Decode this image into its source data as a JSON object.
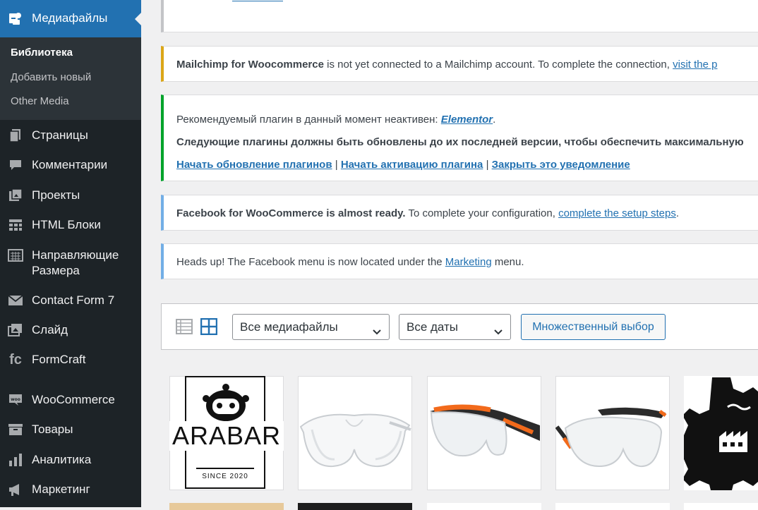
{
  "sidebar": {
    "active": {
      "label": "Медиафайлы",
      "icon": "media-icon"
    },
    "submenu": [
      {
        "label": "Библиотека",
        "current": true
      },
      {
        "label": "Добавить новый",
        "current": false
      },
      {
        "label": "Other Media",
        "current": false
      }
    ],
    "items": [
      {
        "label": "Страницы",
        "icon": "pages-icon"
      },
      {
        "label": "Комментарии",
        "icon": "comments-icon"
      },
      {
        "label": "Проекты",
        "icon": "portfolio-icon"
      },
      {
        "label": "HTML Блоки",
        "icon": "html-blocks-icon"
      },
      {
        "label": "Направляющие Размера",
        "line1": "Направляющие",
        "line2": "Размера",
        "icon": "size-guide-icon"
      },
      {
        "label": "Contact Form 7",
        "icon": "mail-icon"
      },
      {
        "label": "Слайд",
        "icon": "slides-icon"
      },
      {
        "label": "FormCraft",
        "icon": "formcraft-icon"
      },
      {
        "label": "WooCommerce",
        "icon": "woocommerce-icon"
      },
      {
        "label": "Товары",
        "icon": "products-icon"
      },
      {
        "label": "Аналитика",
        "icon": "analytics-icon"
      },
      {
        "label": "Маркетинг",
        "icon": "marketing-icon"
      }
    ]
  },
  "notices": {
    "mailchimp": {
      "bold": "Mailchimp for Woocommerce",
      "text": " is not yet connected to a Mailchimp account. To complete the connection, ",
      "link": "visit the p",
      "color": "#dba617"
    },
    "plugins": {
      "line1_text": "Рекомендуемый плагин в данный момент неактивен: ",
      "line1_link": "Elementor",
      "line1_end": ".",
      "line2_text": "Следующие плагины должны быть обновлены до их последней версии, чтобы обеспечить максимальную",
      "link_update": "Начать обновление плагинов",
      "sep": " | ",
      "link_activate": "Начать активацию плагина",
      "link_dismiss": "Закрыть это уведомление",
      "color": "#00a32a"
    },
    "facebook": {
      "bold": "Facebook for WooCommerce is almost ready.",
      "text": " To complete your configuration, ",
      "link": "complete the setup steps",
      "end": ".",
      "color": "#72aee6"
    },
    "heads_up": {
      "text": "Heads up! The Facebook menu is now located under the ",
      "link": "Marketing",
      "end": " menu.",
      "color": "#72aee6"
    }
  },
  "toolbar": {
    "filter_type": "Все медиафайлы",
    "filter_date": "Все даты",
    "bulk_select": "Множественный выбор"
  },
  "media": {
    "logo_text": "ARABAR",
    "logo_since": "SINCE 2020",
    "items": [
      {
        "icon": "arabar-logo-icon"
      },
      {
        "icon": "safety-glasses-clear-icon"
      },
      {
        "icon": "safety-glasses-orange-icon"
      },
      {
        "icon": "safety-glasses-tinted-icon"
      },
      {
        "icon": "factory-gear-icon"
      }
    ]
  }
}
